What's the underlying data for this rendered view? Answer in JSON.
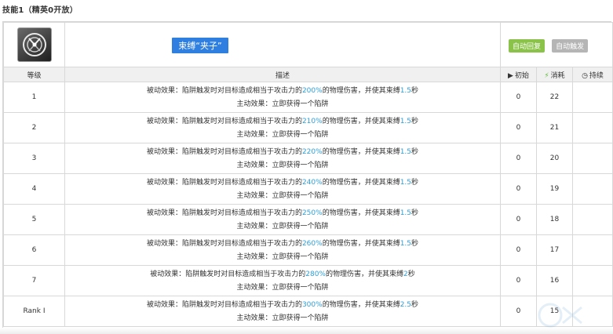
{
  "page_title": "技能1（精英0开放）",
  "skill": {
    "icon": "trap-clamp-icon",
    "name": "束缚“夹子”",
    "tags": [
      "自动回复",
      "自动触发"
    ]
  },
  "columns": {
    "level": "等级",
    "desc": "描述",
    "initial": "初始",
    "cost": "消耗",
    "duration": "持续"
  },
  "rows": [
    {
      "level": "1",
      "pre": "被动效果：陷阱触发时对目标造成相当于攻击力的",
      "pct": "200%",
      "mid": "的物理伤害，并使其束缚",
      "sec": "1.5",
      "post": "秒",
      "active": "主动效果：立即获得一个陷阱",
      "initial": "0",
      "cost": "22",
      "duration": ""
    },
    {
      "level": "2",
      "pre": "被动效果：陷阱触发时对目标造成相当于攻击力的",
      "pct": "210%",
      "mid": "的物理伤害，并使其束缚",
      "sec": "1.5",
      "post": "秒",
      "active": "主动效果：立即获得一个陷阱",
      "initial": "0",
      "cost": "21",
      "duration": ""
    },
    {
      "level": "3",
      "pre": "被动效果：陷阱触发时对目标造成相当于攻击力的",
      "pct": "220%",
      "mid": "的物理伤害，并使其束缚",
      "sec": "1.5",
      "post": "秒",
      "active": "主动效果：立即获得一个陷阱",
      "initial": "0",
      "cost": "20",
      "duration": ""
    },
    {
      "level": "4",
      "pre": "被动效果：陷阱触发时对目标造成相当于攻击力的",
      "pct": "240%",
      "mid": "的物理伤害，并使其束缚",
      "sec": "1.5",
      "post": "秒",
      "active": "主动效果：立即获得一个陷阱",
      "initial": "0",
      "cost": "19",
      "duration": ""
    },
    {
      "level": "5",
      "pre": "被动效果：陷阱触发时对目标造成相当于攻击力的",
      "pct": "250%",
      "mid": "的物理伤害，并使其束缚",
      "sec": "1.5",
      "post": "秒",
      "active": "主动效果：立即获得一个陷阱",
      "initial": "0",
      "cost": "18",
      "duration": ""
    },
    {
      "level": "6",
      "pre": "被动效果：陷阱触发时对目标造成相当于攻击力的",
      "pct": "260%",
      "mid": "的物理伤害，并使其束缚",
      "sec": "1.5",
      "post": "秒",
      "active": "主动效果：立即获得一个陷阱",
      "initial": "0",
      "cost": "17",
      "duration": ""
    },
    {
      "level": "7",
      "pre": "被动效果：陷阱触发时对目标造成相当于攻击力的",
      "pct": "280%",
      "mid": "的物理伤害，并使其束缚",
      "sec": "2",
      "post": "秒",
      "active": "主动效果：立即获得一个陷阱",
      "initial": "0",
      "cost": "16",
      "duration": ""
    },
    {
      "level": "Rank Ⅰ",
      "pre": "被动效果：陷阱触发时对目标造成相当于攻击力的",
      "pct": "300%",
      "mid": "的物理伤害，并使其束缚",
      "sec": "2.5",
      "post": "秒",
      "active": "主动效果：立即获得一个陷阱",
      "initial": "0",
      "cost": "15",
      "duration": ""
    }
  ],
  "colors": {
    "highlight": "#2f9fd8",
    "skill_name_bg": "#2f7fe0",
    "tag_green": "#8bc34a",
    "tag_gray": "#b5b5b5"
  }
}
